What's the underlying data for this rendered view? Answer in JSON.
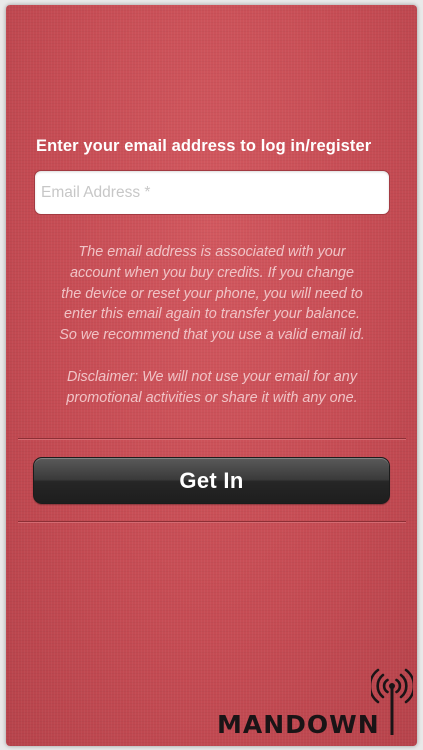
{
  "login": {
    "prompt": "Enter your email address to log in/register",
    "email_placeholder": "Email Address *",
    "email_value": "",
    "info_paragraph": "The email address is associated with your\naccount  when you buy credits. If you change\nthe device or reset your phone, you will need to\nenter this email again to transfer your balance.\nSo we recommend that you use a valid email id.",
    "disclaimer": "Disclaimer: We will not use your email for any\npromotional activities or share it with any one.",
    "button_label": "Get In"
  },
  "brand": {
    "logo_text": "MANDOWN",
    "logo_icon": "antenna-broadcast-icon"
  },
  "colors": {
    "background": "#c64c54",
    "info_text": "#f0c3c6",
    "button": "#2e2e2e"
  }
}
